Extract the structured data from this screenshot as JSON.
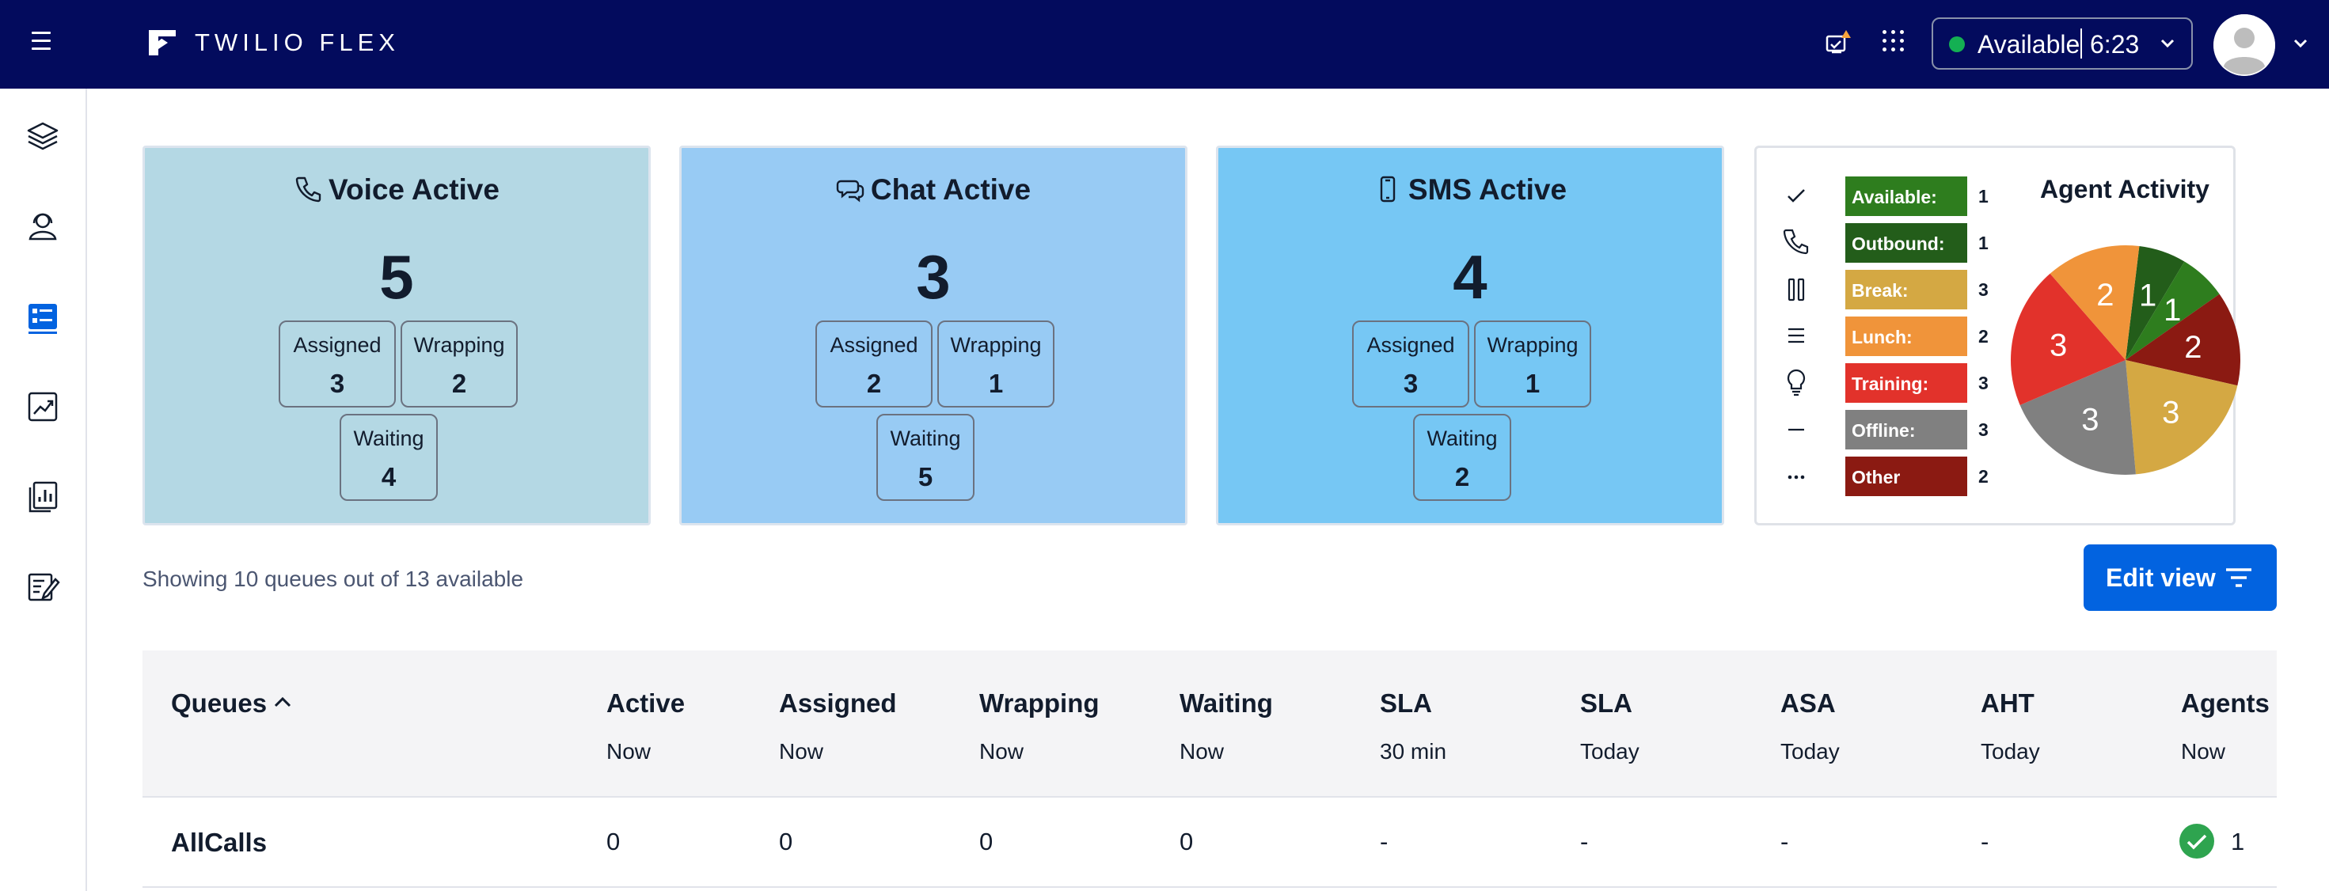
{
  "app": {
    "brand": "TWILIO FLEX",
    "status_label": "Available",
    "status_time": "6:23",
    "status_color": "#14b053",
    "header_bg": "#030b5d"
  },
  "sidebar": {
    "items": [
      {
        "icon": "layers-icon"
      },
      {
        "icon": "agents-icon"
      },
      {
        "icon": "queues-dashboard-icon",
        "active": true
      },
      {
        "icon": "analytics-icon"
      },
      {
        "icon": "reports-icon"
      },
      {
        "icon": "tasks-icon"
      }
    ]
  },
  "tiles": {
    "voice": {
      "title": "Voice Active",
      "count": "5",
      "assigned_label": "Assigned",
      "assigned": "3",
      "wrapping_label": "Wrapping",
      "wrapping": "2",
      "waiting_label": "Waiting",
      "waiting": "4",
      "color": "#b4d8e4"
    },
    "chat": {
      "title": "Chat Active",
      "count": "3",
      "assigned_label": "Assigned",
      "assigned": "2",
      "wrapping_label": "Wrapping",
      "wrapping": "1",
      "waiting_label": "Waiting",
      "waiting": "5",
      "color": "#98cbf4"
    },
    "sms": {
      "title": "SMS Active",
      "count": "4",
      "assigned_label": "Assigned",
      "assigned": "3",
      "wrapping_label": "Wrapping",
      "wrapping": "1",
      "waiting_label": "Waiting",
      "waiting": "2",
      "color": "#76c7f4"
    }
  },
  "agent_activity": {
    "title": "Agent Activity",
    "legend": [
      {
        "label": "Available:",
        "count": "1",
        "color": "#2e7d1e",
        "icon": "check-icon"
      },
      {
        "label": "Outbound:",
        "count": "1",
        "color": "#235d1a",
        "icon": "phone-icon"
      },
      {
        "label": "Break:",
        "count": "3",
        "color": "#d4a843",
        "icon": "pause-icon"
      },
      {
        "label": "Lunch:",
        "count": "2",
        "color": "#f0943a",
        "icon": "menu-icon"
      },
      {
        "label": "Training:",
        "count": "3",
        "color": "#e2322b",
        "icon": "lightbulb-icon"
      },
      {
        "label": "Offline:",
        "count": "3",
        "color": "#808080",
        "icon": "dash-icon"
      },
      {
        "label": "Other",
        "count": "2",
        "color": "#8b1a12",
        "icon": "more-icon"
      }
    ]
  },
  "chart_data": {
    "type": "pie",
    "labels": [
      "Outbound",
      "Available",
      "Other",
      "Break",
      "Offline",
      "Training",
      "Lunch"
    ],
    "values": [
      1,
      1,
      2,
      3,
      3,
      3,
      2
    ],
    "colors": [
      "#235d1a",
      "#2e7d1e",
      "#8b1a12",
      "#d4a843",
      "#808080",
      "#e2322b",
      "#f0943a"
    ]
  },
  "queues_summary": {
    "showing_text": "Showing 10 queues out of 13 available",
    "edit_label": "Edit view"
  },
  "table": {
    "columns": [
      {
        "label": "Queues",
        "sub": ""
      },
      {
        "label": "Active",
        "sub": "Now"
      },
      {
        "label": "Assigned",
        "sub": "Now"
      },
      {
        "label": "Wrapping",
        "sub": "Now"
      },
      {
        "label": "Waiting",
        "sub": "Now"
      },
      {
        "label": "SLA",
        "sub": "30 min"
      },
      {
        "label": "SLA",
        "sub": "Today"
      },
      {
        "label": "ASA",
        "sub": "Today"
      },
      {
        "label": "AHT",
        "sub": "Today"
      },
      {
        "label": "Agents",
        "sub": "Now"
      }
    ],
    "rows": [
      {
        "name": "AllCalls",
        "active": "0",
        "assigned": "0",
        "wrapping": "0",
        "waiting": "0",
        "sla30": "-",
        "sla_today": "-",
        "asa": "-",
        "aht": "-",
        "agents": "1"
      }
    ]
  }
}
